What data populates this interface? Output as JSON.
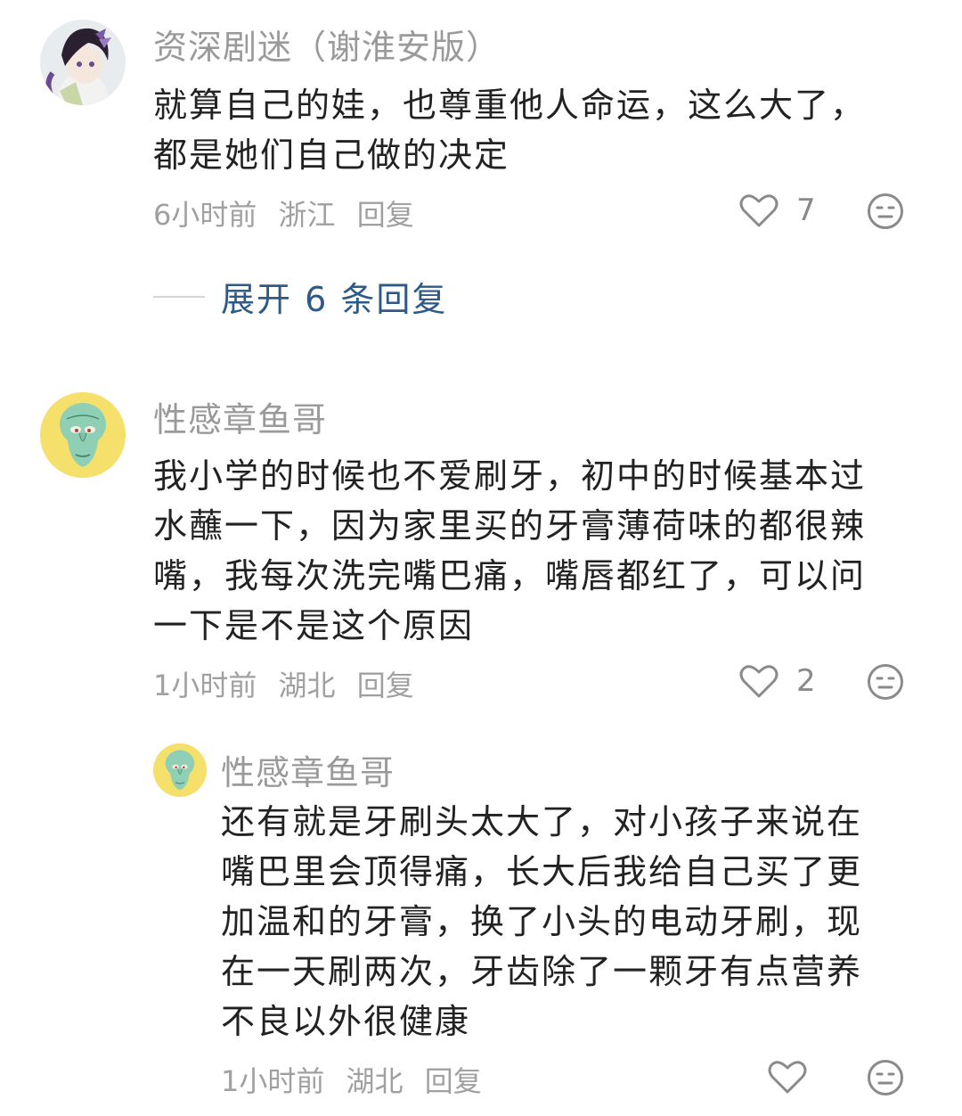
{
  "comments": [
    {
      "username": "资深剧迷（谢淮安版）",
      "lines": [
        "就算自己的娃，也尊重他人命运，这么大了，",
        "都是她们自己做的决定"
      ],
      "time": "6小时前",
      "location": "浙江",
      "reply_label": "回复",
      "likes": "7",
      "avatar_icon": "anime-character-avatar",
      "expand_replies": {
        "label": "展开 6 条回复"
      }
    },
    {
      "username": "性感章鱼哥",
      "lines": [
        "我小学的时候也不爱刷牙，初中的时候基本过",
        "水蘸一下，因为家里买的牙膏薄荷味的都很辣",
        "嘴，我每次洗完嘴巴痛，嘴唇都红了，可以问",
        "一下是不是这个原因"
      ],
      "time": "1小时前",
      "location": "湖北",
      "reply_label": "回复",
      "likes": "2",
      "avatar_icon": "squidward-avatar"
    }
  ],
  "reply": {
    "username": "性感章鱼哥",
    "lines": [
      "还有就是牙刷头太大了，对小孩子来说在",
      "嘴巴里会顶得痛，长大后我给自己买了更",
      "加温和的牙膏，换了小头的电动牙刷，现",
      "在一天刷两次，牙齿除了一颗牙有点营养",
      "不良以外很健康"
    ],
    "time": "1小时前",
    "location": "湖北",
    "reply_label": "回复",
    "avatar_icon": "squidward-avatar"
  },
  "icons": {
    "like": "heart-icon",
    "dislike": "meh-face-icon"
  },
  "colors": {
    "username": "#9a9a9a",
    "text": "#222222",
    "meta": "#a0a0a0",
    "link": "#2f5a86"
  }
}
